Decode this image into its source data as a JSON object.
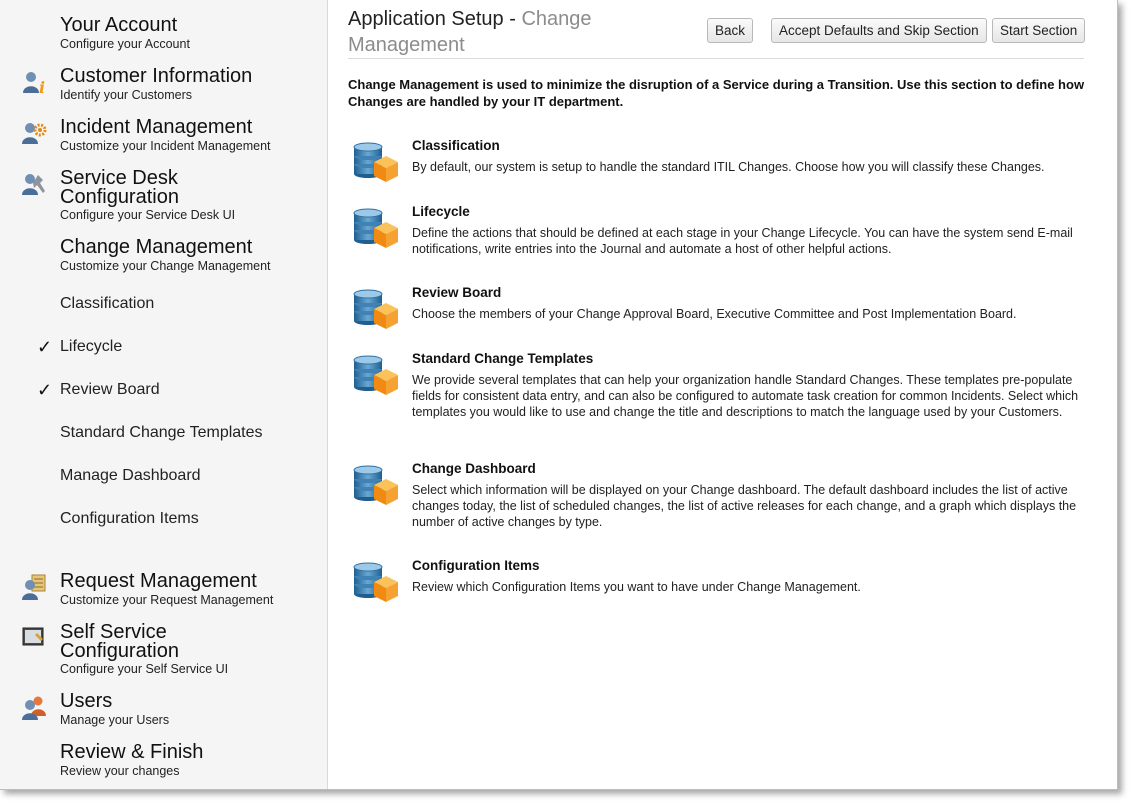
{
  "sidebar": {
    "sections": [
      {
        "title": "Your Account",
        "subtitle": "Configure your Account",
        "icon": "none"
      },
      {
        "title": "Customer Information",
        "subtitle": "Identify your Customers",
        "icon": "user-info-icon"
      },
      {
        "title": "Incident Management",
        "subtitle": "Customize your Incident Management",
        "icon": "gear-user-icon"
      },
      {
        "title_lines": [
          "Service Desk",
          "Configuration"
        ],
        "subtitle": "Configure your Service Desk UI",
        "icon": "wrench-user-icon"
      },
      {
        "title": "Change Management",
        "subtitle": "Customize your Change Management",
        "icon": "none"
      },
      {
        "title": "Request Management",
        "subtitle": "Customize your Request Management",
        "icon": "document-user-icon"
      },
      {
        "title_lines": [
          "Self Service",
          "Configuration"
        ],
        "subtitle": "Configure your Self Service UI",
        "icon": "monitor-icon"
      },
      {
        "title": "Users",
        "subtitle": "Manage your Users",
        "icon": "users-icon"
      },
      {
        "title": "Review & Finish",
        "subtitle": "Review your changes",
        "icon": "none"
      }
    ],
    "change_subitems": [
      {
        "label": "Classification",
        "checked": false
      },
      {
        "label": "Lifecycle",
        "checked": true
      },
      {
        "label": "Review Board",
        "checked": true
      },
      {
        "label": "Standard Change Templates",
        "checked": false
      },
      {
        "label": "Manage Dashboard",
        "checked": false
      },
      {
        "label": "Configuration Items",
        "checked": false
      }
    ],
    "check_glyph": "✓"
  },
  "header": {
    "title_prefix": "Application Setup - ",
    "title_accent": "Change Management",
    "buttons": {
      "back": "Back",
      "accept": "Accept Defaults and Skip Section",
      "start": "Start Section"
    }
  },
  "intro": "Change Management is used to minimize the disruption of a Service during a Transition. Use this section to define how Changes are handled by your IT department.",
  "items": [
    {
      "title": "Classification",
      "desc": "By default, our system is setup to handle the standard ITIL Changes. Choose how you will classify these Changes."
    },
    {
      "title": "Lifecycle",
      "desc": "Define the actions that should be defined at each stage in your Change Lifecycle. You can have the system send E-mail notifications, write entries into the Journal and automate a host of other helpful actions."
    },
    {
      "title": "Review Board",
      "desc": "Choose the members of your Change Approval Board, Executive Committee and Post Implementation Board."
    },
    {
      "title": "Standard Change Templates",
      "desc": "We provide several templates that can help your organization handle Standard Changes. These templates pre-populate fields for consistent data entry, and can also be configured to automate task creation for common Incidents. Select which templates you would like to use and change the title and descriptions to match the language used by your Customers."
    },
    {
      "title": "Change Dashboard",
      "desc": "Select which information will be displayed on your Change dashboard. The default dashboard includes the list of active changes today, the list of scheduled changes, the list of active releases for each change, and a graph which displays the number of active changes by type."
    },
    {
      "title": "Configuration Items",
      "desc": "Review which Configuration Items you want to have under Change Management."
    }
  ],
  "colors": {
    "accent": "#8c8c8c",
    "db_blue": "#2f6fa3",
    "box_orange": "#f39a1e"
  }
}
